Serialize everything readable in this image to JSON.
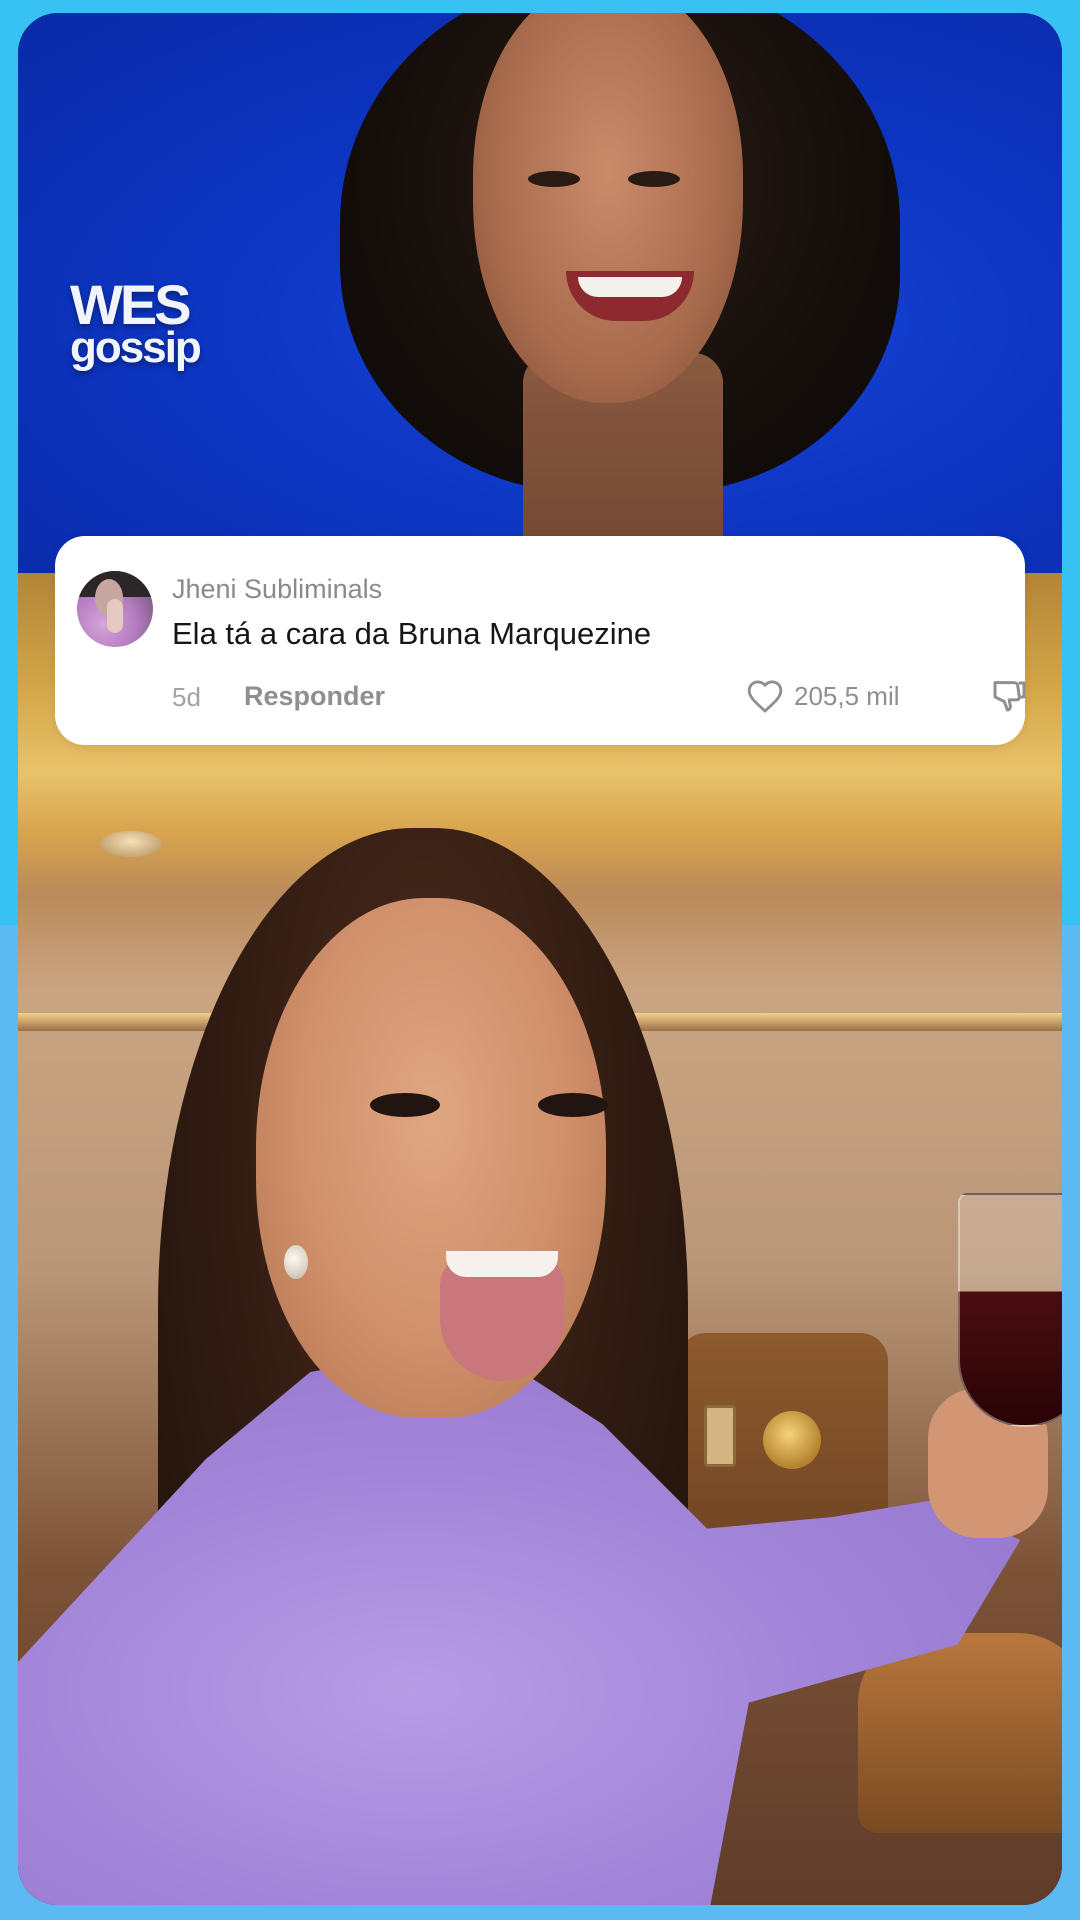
{
  "brand": {
    "logo_line1": "WES",
    "logo_line2": "gossip"
  },
  "comment": {
    "username": "Jheni Subliminals",
    "text": "Ela tá a cara da Bruna Marquezine",
    "time": "5d",
    "reply_label": "Responder",
    "likes": "205,5 mil",
    "icons": {
      "like": "heart-outline-icon",
      "dislike": "thumbs-down-outline-icon"
    }
  },
  "colors": {
    "background_top": "#38c2f4",
    "background_bottom": "#5db9f2",
    "top_photo_backdrop": "#0d36c4",
    "card": "#ffffff",
    "username": "#8a8a8a",
    "comment_text": "#161616",
    "meta_text": "#8f8f8f"
  }
}
